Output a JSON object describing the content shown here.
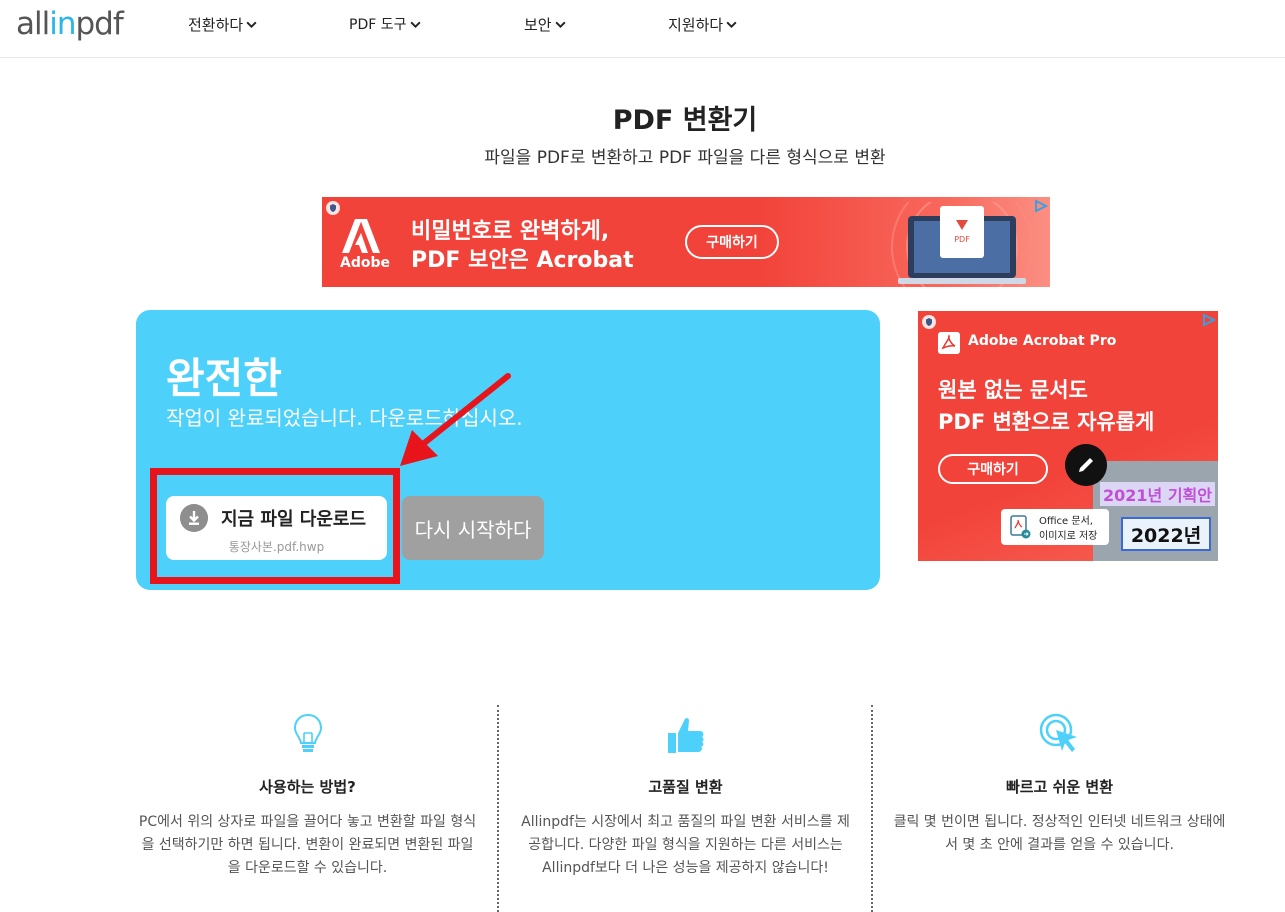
{
  "header": {
    "logo": {
      "pre": "all",
      "accent": "in",
      "post": "pdf"
    },
    "nav": [
      "전환하다",
      "PDF 도구",
      "보안",
      "지원하다"
    ]
  },
  "page": {
    "title": "PDF 변환기",
    "subtitle": "파일을 PDF로 변환하고 PDF 파일을 다른 형식으로 변환"
  },
  "ad_top": {
    "brand": "Adobe",
    "line1": "비밀번호로 완벽하게,",
    "line2": "PDF 보안은 Acrobat",
    "button": "구매하기",
    "icon_label": "PDF"
  },
  "completion": {
    "title": "완전한",
    "message": "작업이 완료되었습니다. 다운로드하십시오.",
    "download_label": "지금 파일 다운로드",
    "file_name": "통장사본.pdf.hwp",
    "restart_label": "다시 시작하다"
  },
  "ad_side": {
    "product": "Adobe Acrobat Pro",
    "line1": "원본 없는 문서도",
    "line2": "PDF 변환으로 자유롭게",
    "button": "구매하기",
    "old_year": "2021년 기획안",
    "card_line1": "Office 문서,",
    "card_line2": "이미지로 저장",
    "new_year": "2022년"
  },
  "features": [
    {
      "icon": "lightbulb-icon",
      "title": "사용하는 방법?",
      "text": "PC에서 위의 상자로 파일을 끌어다 놓고 변환할 파일 형식을 선택하기만 하면 됩니다. 변환이 완료되면 변환된 파일을 다운로드할 수 있습니다."
    },
    {
      "icon": "thumbs-up-icon",
      "title": "고품질 변환",
      "text": "Allinpdf는 시장에서 최고 품질의 파일 변환 서비스를 제공합니다. 다양한 파일 형식을 지원하는 다른 서비스는 Allinpdf보다 더 나은 성능을 제공하지 않습니다!"
    },
    {
      "icon": "click-icon",
      "title": "빠르고 쉬운 변환",
      "text": "클릭 몇 번이면 됩니다. 정상적인 인터넷 네트워크 상태에서 몇 초 안에 결과를 얻을 수 있습니다."
    }
  ],
  "colors": {
    "accent": "#4dd1fa",
    "highlight": "#e8141b",
    "ad_red": "#f2433a",
    "logo_blue": "#29b6e8"
  }
}
